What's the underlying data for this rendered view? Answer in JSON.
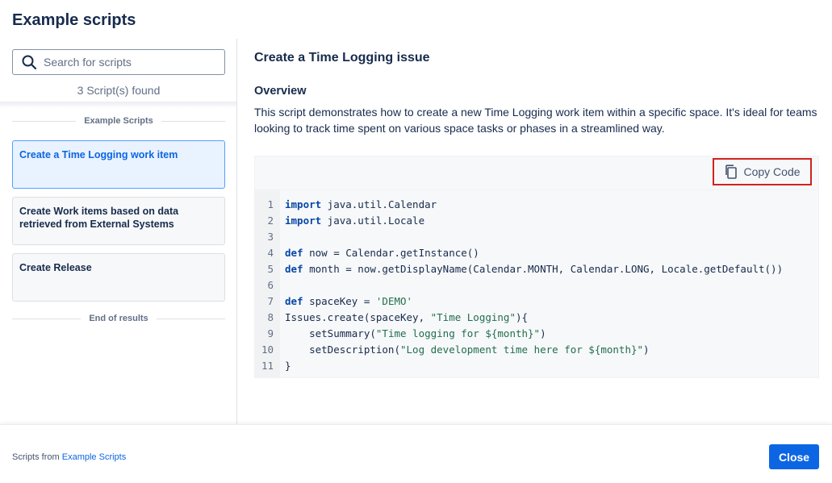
{
  "modal": {
    "title": "Example scripts"
  },
  "search": {
    "placeholder": "Search for scripts",
    "value": ""
  },
  "results": {
    "count_text": "3 Script(s) found",
    "section_label": "Example Scripts",
    "end_label": "End of results",
    "items": [
      {
        "label": "Create a Time Logging work item",
        "selected": true
      },
      {
        "label": "Create Work items based on data retrieved from External Systems",
        "selected": false
      },
      {
        "label": "Create Release",
        "selected": false
      }
    ]
  },
  "detail": {
    "title": "Create a Time Logging issue",
    "overview_heading": "Overview",
    "overview_text": "This script demonstrates how to create a new Time Logging work item within a specific space. It's ideal for teams looking to track time spent on various space tasks or phases in a streamlined way.",
    "copy_label": "Copy Code",
    "code_lines": [
      "import java.util.Calendar",
      "import java.util.Locale",
      "",
      "def now = Calendar.getInstance()",
      "def month = now.getDisplayName(Calendar.MONTH, Calendar.LONG, Locale.getDefault())",
      "",
      "def spaceKey = 'DEMO'",
      "Issues.create(spaceKey, \"Time Logging\"){",
      "    setSummary(\"Time logging for ${month}\")",
      "    setDescription(\"Log development time here for ${month}\")",
      "}"
    ]
  },
  "footer": {
    "note_prefix": "Scripts from",
    "note_link": "Example Scripts",
    "close_label": "Close"
  },
  "colors": {
    "primary": "#0c66e4",
    "highlight_border": "#d12121",
    "selected_bg": "#e9f2ff"
  },
  "icons": {
    "search": "search-icon",
    "copy": "copy-icon"
  }
}
